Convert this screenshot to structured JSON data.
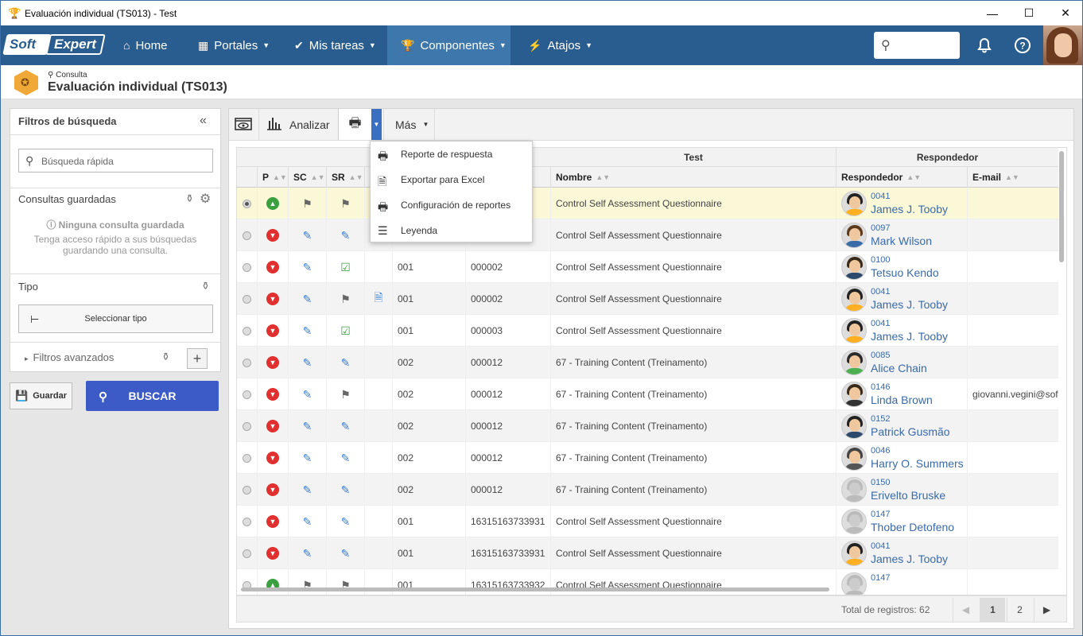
{
  "window": {
    "title": "Evaluación individual (TS013) - Test",
    "min": "—",
    "max": "☐",
    "close": "✕"
  },
  "nav": {
    "logo_a": "Soft",
    "logo_b": "Expert",
    "items": [
      {
        "label": "Home"
      },
      {
        "label": "Portales"
      },
      {
        "label": "Mis tareas"
      },
      {
        "label": "Componentes"
      },
      {
        "label": "Atajos"
      }
    ]
  },
  "header": {
    "breadcrumb": "Consulta",
    "title": "Evaluación individual (TS013)"
  },
  "filters": {
    "title": "Filtros de búsqueda",
    "quick_search_placeholder": "Búsqueda rápida",
    "saved_title": "Consultas guardadas",
    "saved_empty": "Ninguna consulta guardada",
    "saved_hint1": "Tenga acceso rápido a sus búsquedas",
    "saved_hint2": "guardando una consulta.",
    "type_label": "Tipo",
    "select_type": "Seleccionar tipo",
    "advanced": "Filtros avanzados"
  },
  "actions": {
    "save": "Guardar",
    "search": "BUSCAR"
  },
  "toolbar": {
    "analyze": "Analizar",
    "more": "Más"
  },
  "menu": {
    "items": [
      {
        "label": "Reporte de respuesta"
      },
      {
        "label": "Exportar para Excel"
      },
      {
        "label": "Configuración de reportes"
      },
      {
        "label": "Leyenda"
      }
    ]
  },
  "grid": {
    "group_test": "Test",
    "group_resp": "Respondedor",
    "cols": {
      "p": "P",
      "sc": "SC",
      "sr": "SR",
      "nombre": "Nombre",
      "resp": "Respondedor",
      "email": "E-mail"
    },
    "rows": [
      {
        "p": "green",
        "sc": "grey",
        "sr": "grey",
        "doc": false,
        "c1": "",
        "c2": "",
        "name": "Control Self Assessment Questionnaire",
        "pid": "0041",
        "pname": "James J. Tooby",
        "email": "",
        "sel": true
      },
      {
        "p": "red",
        "sc": "blue",
        "sr": "blue",
        "doc": false,
        "c1": "",
        "c2": "",
        "name": "Control Self Assessment Questionnaire",
        "pid": "0097",
        "pname": "Mark Wilson",
        "email": "",
        "sel": false
      },
      {
        "p": "red",
        "sc": "blue",
        "sr": "green",
        "doc": false,
        "c1": "001",
        "c2": "000002",
        "name": "Control Self Assessment Questionnaire",
        "pid": "0100",
        "pname": "Tetsuo Kendo",
        "email": "",
        "sel": false
      },
      {
        "p": "red",
        "sc": "blue",
        "sr": "grey",
        "doc": true,
        "c1": "001",
        "c2": "000002",
        "name": "Control Self Assessment Questionnaire",
        "pid": "0041",
        "pname": "James J. Tooby",
        "email": "",
        "sel": false
      },
      {
        "p": "red",
        "sc": "blue",
        "sr": "green",
        "doc": false,
        "c1": "001",
        "c2": "000003",
        "name": "Control Self Assessment Questionnaire",
        "pid": "0041",
        "pname": "James J. Tooby",
        "email": "",
        "sel": false
      },
      {
        "p": "red",
        "sc": "blue",
        "sr": "blue",
        "doc": false,
        "c1": "002",
        "c2": "000012",
        "name": "67 - Training Content (Treinamento)",
        "pid": "0085",
        "pname": "Alice Chain",
        "email": "",
        "sel": false
      },
      {
        "p": "red",
        "sc": "blue",
        "sr": "grey",
        "doc": false,
        "c1": "002",
        "c2": "000012",
        "name": "67 - Training Content (Treinamento)",
        "pid": "0146",
        "pname": "Linda Brown",
        "email": "giovanni.vegini@sof",
        "sel": false
      },
      {
        "p": "red",
        "sc": "blue",
        "sr": "blue",
        "doc": false,
        "c1": "002",
        "c2": "000012",
        "name": "67 - Training Content (Treinamento)",
        "pid": "0152",
        "pname": "Patrick Gusmão",
        "email": "",
        "sel": false
      },
      {
        "p": "red",
        "sc": "blue",
        "sr": "blue",
        "doc": false,
        "c1": "002",
        "c2": "000012",
        "name": "67 - Training Content (Treinamento)",
        "pid": "0046",
        "pname": "Harry O. Summers",
        "email": "",
        "sel": false
      },
      {
        "p": "red",
        "sc": "blue",
        "sr": "blue",
        "doc": false,
        "c1": "002",
        "c2": "000012",
        "name": "67 - Training Content (Treinamento)",
        "pid": "0150",
        "pname": "Erivelto Bruske",
        "email": "",
        "sel": false
      },
      {
        "p": "red",
        "sc": "blue",
        "sr": "blue",
        "doc": false,
        "c1": "001",
        "c2": "16315163733931",
        "name": "Control Self Assessment Questionnaire",
        "pid": "0147",
        "pname": "Thober Detofeno",
        "email": "",
        "sel": false
      },
      {
        "p": "red",
        "sc": "blue",
        "sr": "blue",
        "doc": false,
        "c1": "001",
        "c2": "16315163733931",
        "name": "Control Self Assessment Questionnaire",
        "pid": "0041",
        "pname": "James J. Tooby",
        "email": "",
        "sel": false
      },
      {
        "p": "green",
        "sc": "grey",
        "sr": "grey",
        "doc": false,
        "c1": "001",
        "c2": "16315163733932",
        "name": "Control Self Assessment Questionnaire",
        "pid": "0147",
        "pname": "",
        "email": "",
        "sel": false
      }
    ]
  },
  "pager": {
    "total": "Total de registros: 62",
    "p1": "1",
    "p2": "2"
  }
}
